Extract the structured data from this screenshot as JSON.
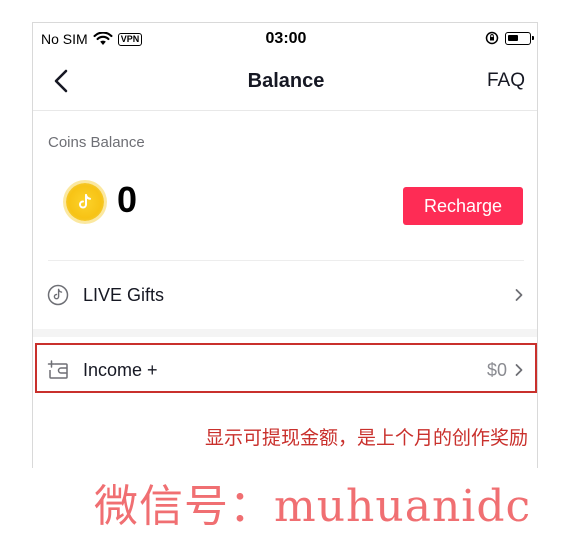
{
  "status_bar": {
    "carrier": "No SIM",
    "vpn": "VPN",
    "time": "03:00"
  },
  "nav": {
    "title": "Balance",
    "faq": "FAQ"
  },
  "coins": {
    "label": "Coins Balance",
    "value": "0",
    "recharge": "Recharge"
  },
  "rows": {
    "gifts_label": "LIVE Gifts",
    "income_label": "Income +",
    "income_value": "$0"
  },
  "annotation": "显示可提现金额，是上个月的创作奖励",
  "watermark": "微信号：muhuanidc",
  "colors": {
    "accent": "#fe2c55",
    "annotation_red": "#c9302c",
    "coin_gold": "#f7c315"
  }
}
